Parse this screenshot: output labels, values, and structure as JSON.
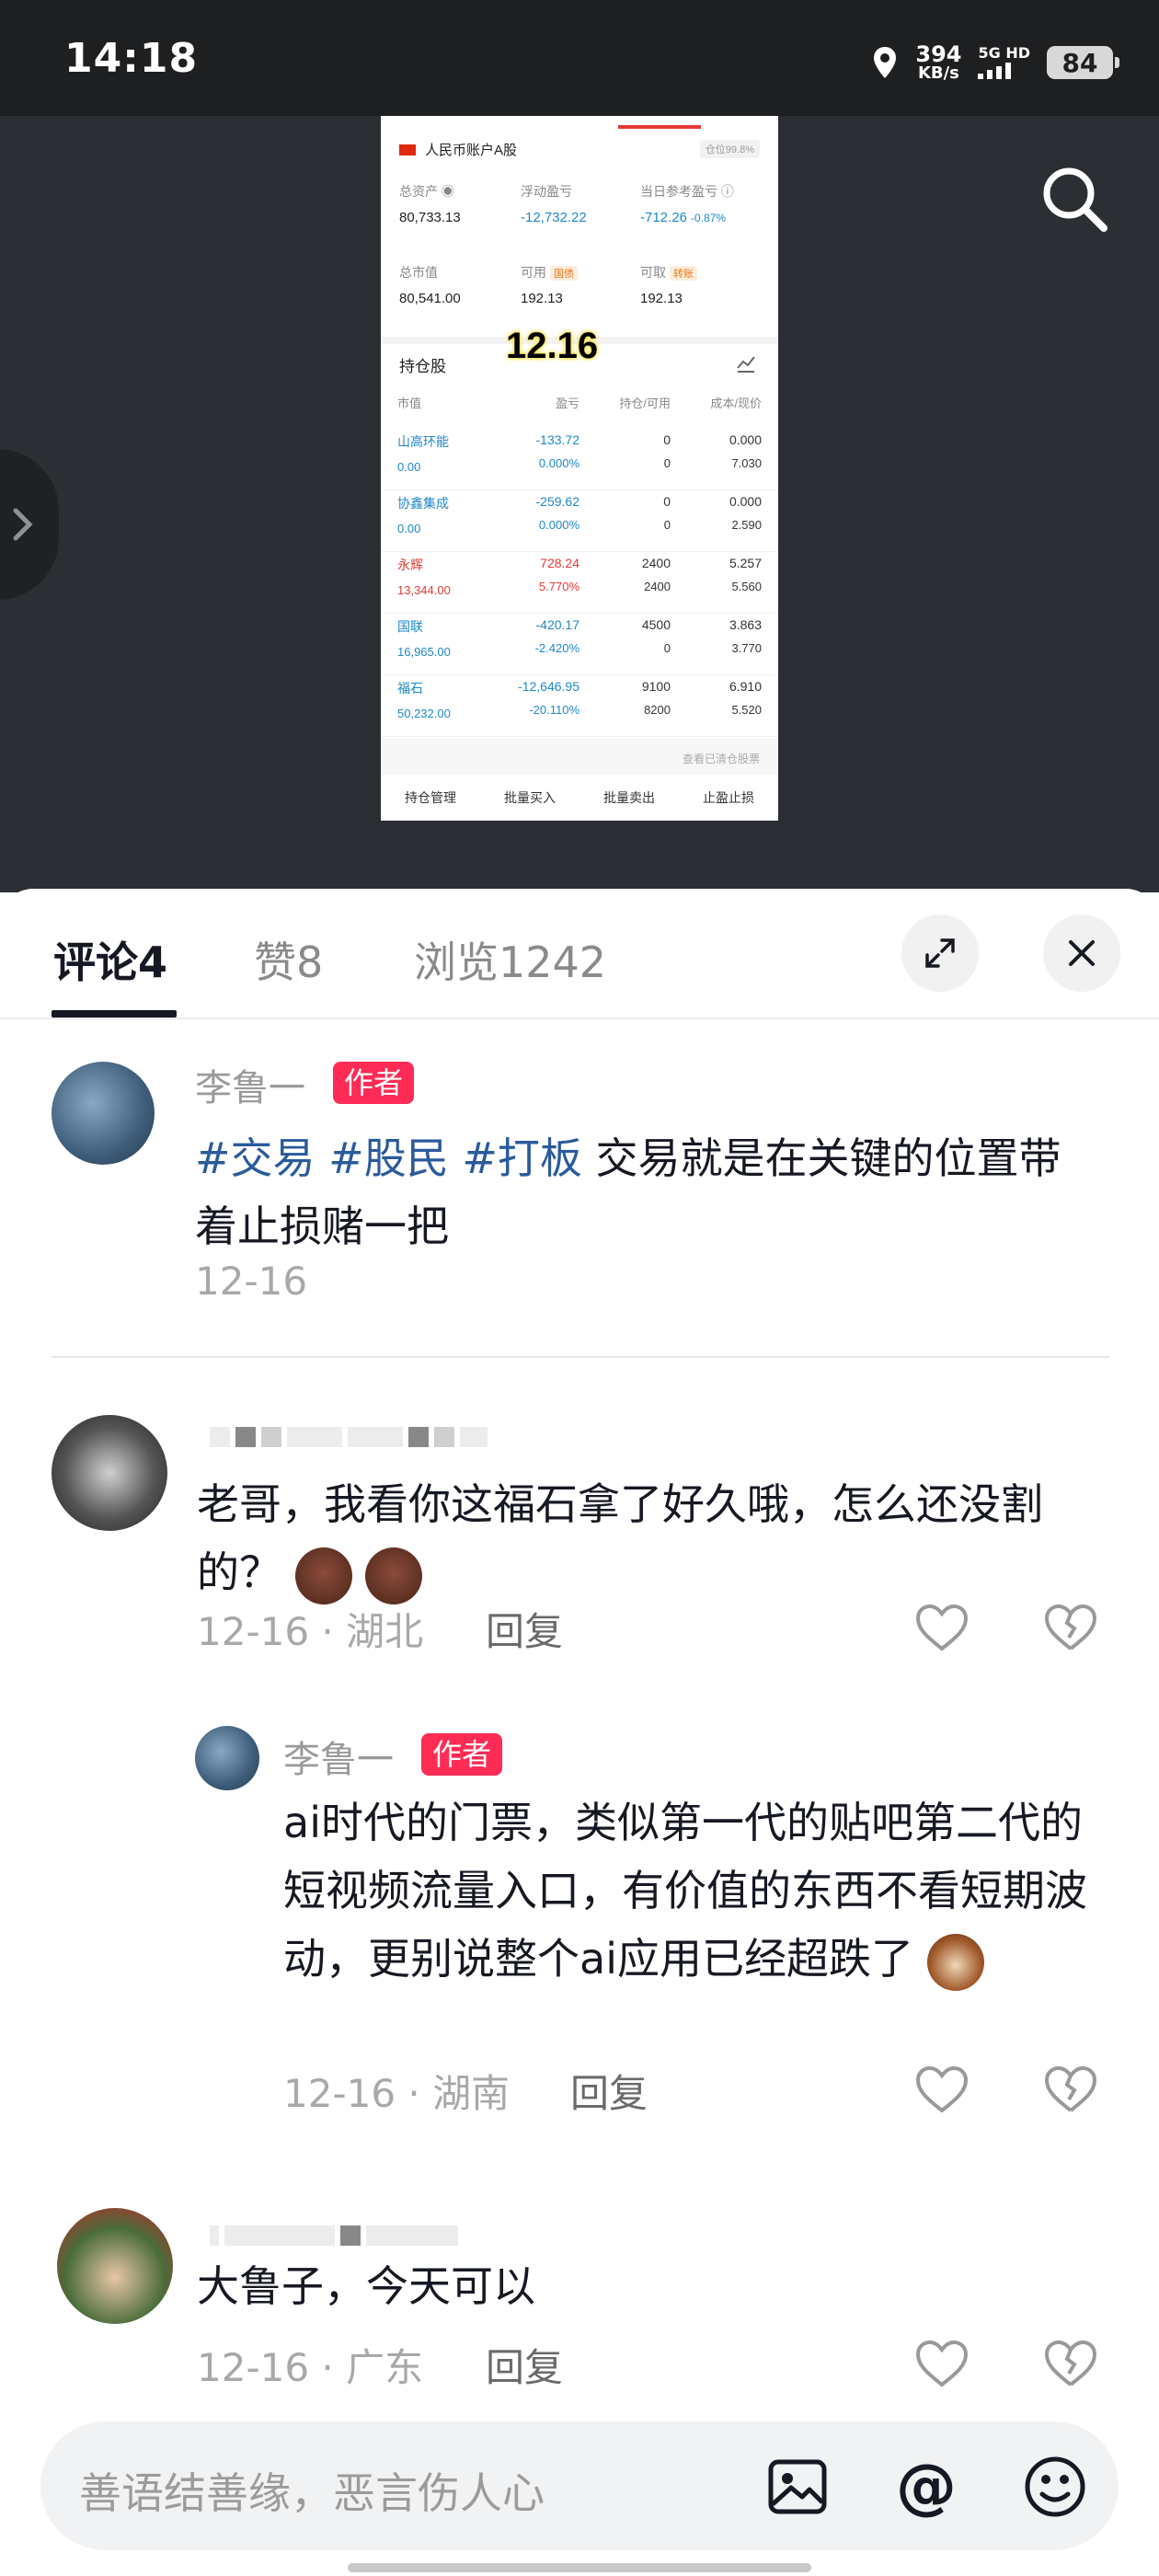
{
  "status_bar": {
    "time": "14:18",
    "speed_value": "394",
    "speed_unit": "KB/s",
    "network_top": "5G HD",
    "battery": "84"
  },
  "post_screenshot": {
    "account_label": "人民币账户A股",
    "position_label": "仓位99.8%",
    "total_assets_label": "总资产",
    "total_assets": "80,733.13",
    "floating_pl_label": "浮动盈亏",
    "floating_pl": "-12,732.22",
    "daily_pl_label": "当日参考盈亏",
    "daily_pl": "-712.26",
    "daily_pl_pct": "-0.87%",
    "market_value_label": "总市值",
    "market_value": "80,541.00",
    "available_label": "可用",
    "available_tag": "国债",
    "available": "192.13",
    "withdrawable_label": "可取",
    "withdrawable_tag": "转账",
    "withdrawable": "192.13",
    "date_overlay": "12.16",
    "holdings_title": "持仓股",
    "columns": [
      "市值",
      "盈亏",
      "持仓/可用",
      "成本/现价"
    ],
    "rows": [
      {
        "name": "山高环能",
        "mv": "0.00",
        "pl": "-133.72",
        "pct": "0.000%",
        "hold": "0",
        "avail": "0",
        "cost": "0.000",
        "price": "7.030",
        "color": "#1e88c8"
      },
      {
        "name": "协鑫集成",
        "mv": "0.00",
        "pl": "-259.62",
        "pct": "0.000%",
        "hold": "0",
        "avail": "0",
        "cost": "0.000",
        "price": "2.590",
        "color": "#1e88c8"
      },
      {
        "name": "永辉",
        "mv": "13,344.00",
        "pl": "728.24",
        "pct": "5.770%",
        "hold": "2400",
        "avail": "2400",
        "cost": "5.257",
        "price": "5.560",
        "color": "#e53935"
      },
      {
        "name": "国联",
        "mv": "16,965.00",
        "pl": "-420.17",
        "pct": "-2.420%",
        "hold": "4500",
        "avail": "0",
        "cost": "3.863",
        "price": "3.770",
        "color": "#1e88c8"
      },
      {
        "name": "福石",
        "mv": "50,232.00",
        "pl": "-12,646.95",
        "pct": "-20.110%",
        "hold": "9100",
        "avail": "8200",
        "cost": "6.910",
        "price": "5.520",
        "color": "#1e88c8"
      }
    ],
    "cleared_link": "查看已清仓股票",
    "footer": [
      "持仓管理",
      "批量买入",
      "批量卖出",
      "止盈止损"
    ]
  },
  "tabs": [
    {
      "label": "评论4"
    },
    {
      "label": "赞8"
    },
    {
      "label": "浏览1242"
    }
  ],
  "comments": {
    "author_post": {
      "name": "李鲁一",
      "tag": "作者",
      "hashtags": "#交易 #股民 #打板",
      "text": " 交易就是在关键的位置带着止损赌一把",
      "date": "12-16"
    },
    "c1": {
      "text": "老哥，我看你这福石拿了好久哦，怎么还没割的？",
      "meta": "12-16 · 湖北",
      "reply": "回复"
    },
    "r1": {
      "name": "李鲁一",
      "tag": "作者",
      "text": "ai时代的门票，类似第一代的贴吧第二代的短视频流量入口，有价值的东西不看短期波动，更别说整个ai应用已经超跌了",
      "meta": "12-16 · 湖南",
      "reply": "回复"
    },
    "c2": {
      "text": "大鲁子，今天可以",
      "meta": "12-16 · 广东",
      "reply": "回复"
    }
  },
  "input": {
    "placeholder": "善语结善缘，恶言伤人心"
  },
  "colors": {
    "accent_red": "#fe2c55",
    "hashtag_blue": "#2a5b9b",
    "stock_up": "#e53935",
    "stock_down": "#1e88c8"
  }
}
